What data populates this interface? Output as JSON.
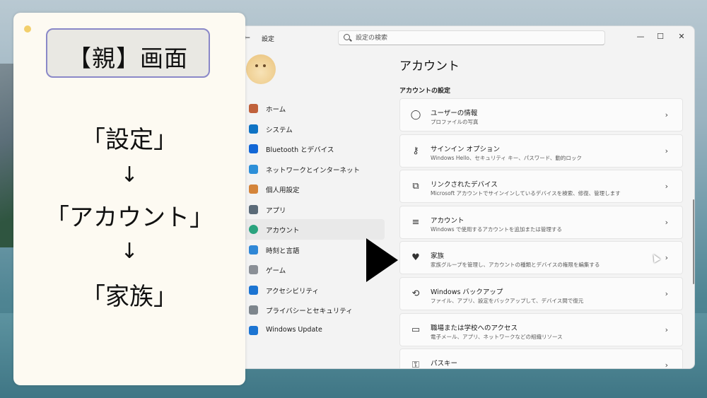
{
  "window": {
    "back_glyph": "←",
    "title": "設定",
    "search_placeholder": "設定の検索",
    "controls": {
      "minimize": "—",
      "maximize": "☐",
      "close": "✕"
    }
  },
  "sidebar": {
    "items": [
      {
        "label": "ホーム",
        "icon": "home-icon",
        "color": "#c0613b"
      },
      {
        "label": "システム",
        "icon": "system-icon",
        "color": "#0f73c4"
      },
      {
        "label": "Bluetooth とデバイス",
        "icon": "bluetooth-icon",
        "color": "#1267d6"
      },
      {
        "label": "ネットワークとインターネット",
        "icon": "wifi-icon",
        "color": "#2d8fd8"
      },
      {
        "label": "個人用設定",
        "icon": "brush-icon",
        "color": "#d4843a"
      },
      {
        "label": "アプリ",
        "icon": "apps-icon",
        "color": "#5a6a78"
      },
      {
        "label": "アカウント",
        "icon": "account-icon",
        "color": "#2aa37e",
        "active": true
      },
      {
        "label": "時刻と言語",
        "icon": "globe-icon",
        "color": "#2f87d6"
      },
      {
        "label": "ゲーム",
        "icon": "gamepad-icon",
        "color": "#8a8f96"
      },
      {
        "label": "アクセシビリティ",
        "icon": "accessibility-icon",
        "color": "#1b74d2"
      },
      {
        "label": "プライバシーとセキュリティ",
        "icon": "shield-icon",
        "color": "#7d858c"
      },
      {
        "label": "Windows Update",
        "icon": "update-icon",
        "color": "#1b74d2"
      }
    ]
  },
  "main": {
    "title": "アカウント",
    "section": "アカウントの設定",
    "cards": [
      {
        "title": "ユーザーの情報",
        "subtitle": "プロファイルの写真",
        "icon": "user-icon",
        "glyph": "◯"
      },
      {
        "title": "サインイン オプション",
        "subtitle": "Windows Hello、セキュリティ キー、パスワード、動的ロック",
        "icon": "key-icon",
        "glyph": "⚷"
      },
      {
        "title": "リンクされたデバイス",
        "subtitle": "Microsoft アカウントでサインインしているデバイスを検索、修復、管理します",
        "icon": "devices-icon",
        "glyph": "⧉"
      },
      {
        "title": "アカウント",
        "subtitle": "Windows で使用するアカウントを追加または管理する",
        "icon": "accounts-list-icon",
        "glyph": "≡"
      },
      {
        "title": "家族",
        "subtitle": "家族グループを管理し、アカウントの種類とデバイスの権限を編集する",
        "icon": "family-heart-icon",
        "glyph": "♥",
        "cursor": true
      },
      {
        "title": "Windows バックアップ",
        "subtitle": "ファイル、アプリ、設定をバックアップして、デバイス間で復元",
        "icon": "backup-icon",
        "glyph": "⟲"
      },
      {
        "title": "職場または学校へのアクセス",
        "subtitle": "電子メール、アプリ、ネットワークなどの組織リソース",
        "icon": "briefcase-icon",
        "glyph": "▭"
      },
      {
        "title": "パスキー",
        "subtitle": "",
        "icon": "passkey-icon",
        "glyph": "⚿"
      }
    ],
    "chevron": "›"
  },
  "overlay": {
    "heading": "【親】画面",
    "steps": [
      "「設定」",
      "「アカウント」",
      "「家族」"
    ],
    "arrow": "↓"
  },
  "colors": {
    "accent": "#2aa37e",
    "panel_bg": "#fdfaf2",
    "heading_border": "#8a88c8",
    "dot": "#f2cf6c"
  }
}
